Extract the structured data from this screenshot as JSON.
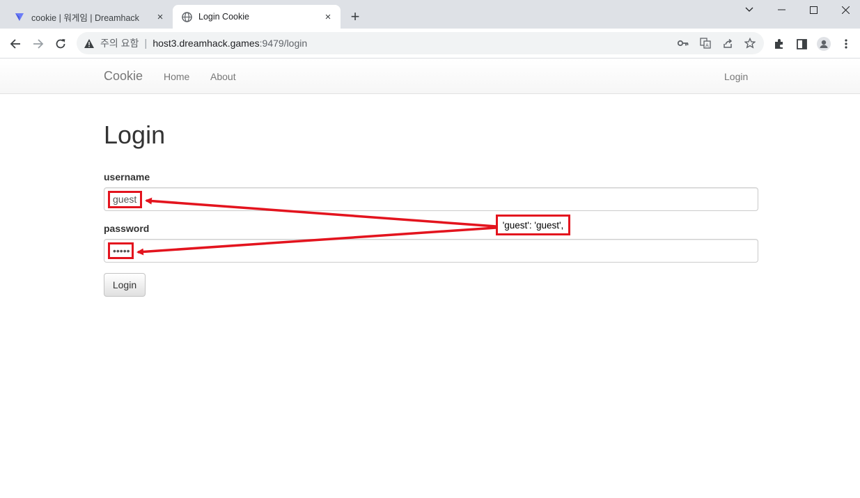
{
  "browser": {
    "tabs": [
      {
        "title": "cookie | 워게임 | Dreamhack",
        "active": false,
        "favicon": "dreamhack-logo-icon"
      },
      {
        "title": "Login Cookie",
        "active": true,
        "favicon": "globe-icon"
      }
    ],
    "close_glyph": "×",
    "new_tab_glyph": "+",
    "security_label": "주의 요함",
    "divider": "|",
    "url_host": "host3.dreamhack.games",
    "url_path": ":9479/login"
  },
  "navbar": {
    "brand": "Cookie",
    "links": [
      "Home",
      "About"
    ],
    "right_link": "Login"
  },
  "form": {
    "title": "Login",
    "username_label": "username",
    "username_value": "guest",
    "password_label": "password",
    "password_value": "guest",
    "submit_label": "Login"
  },
  "annotation": {
    "text": "'guest': 'guest',",
    "color": "#e3141e"
  }
}
